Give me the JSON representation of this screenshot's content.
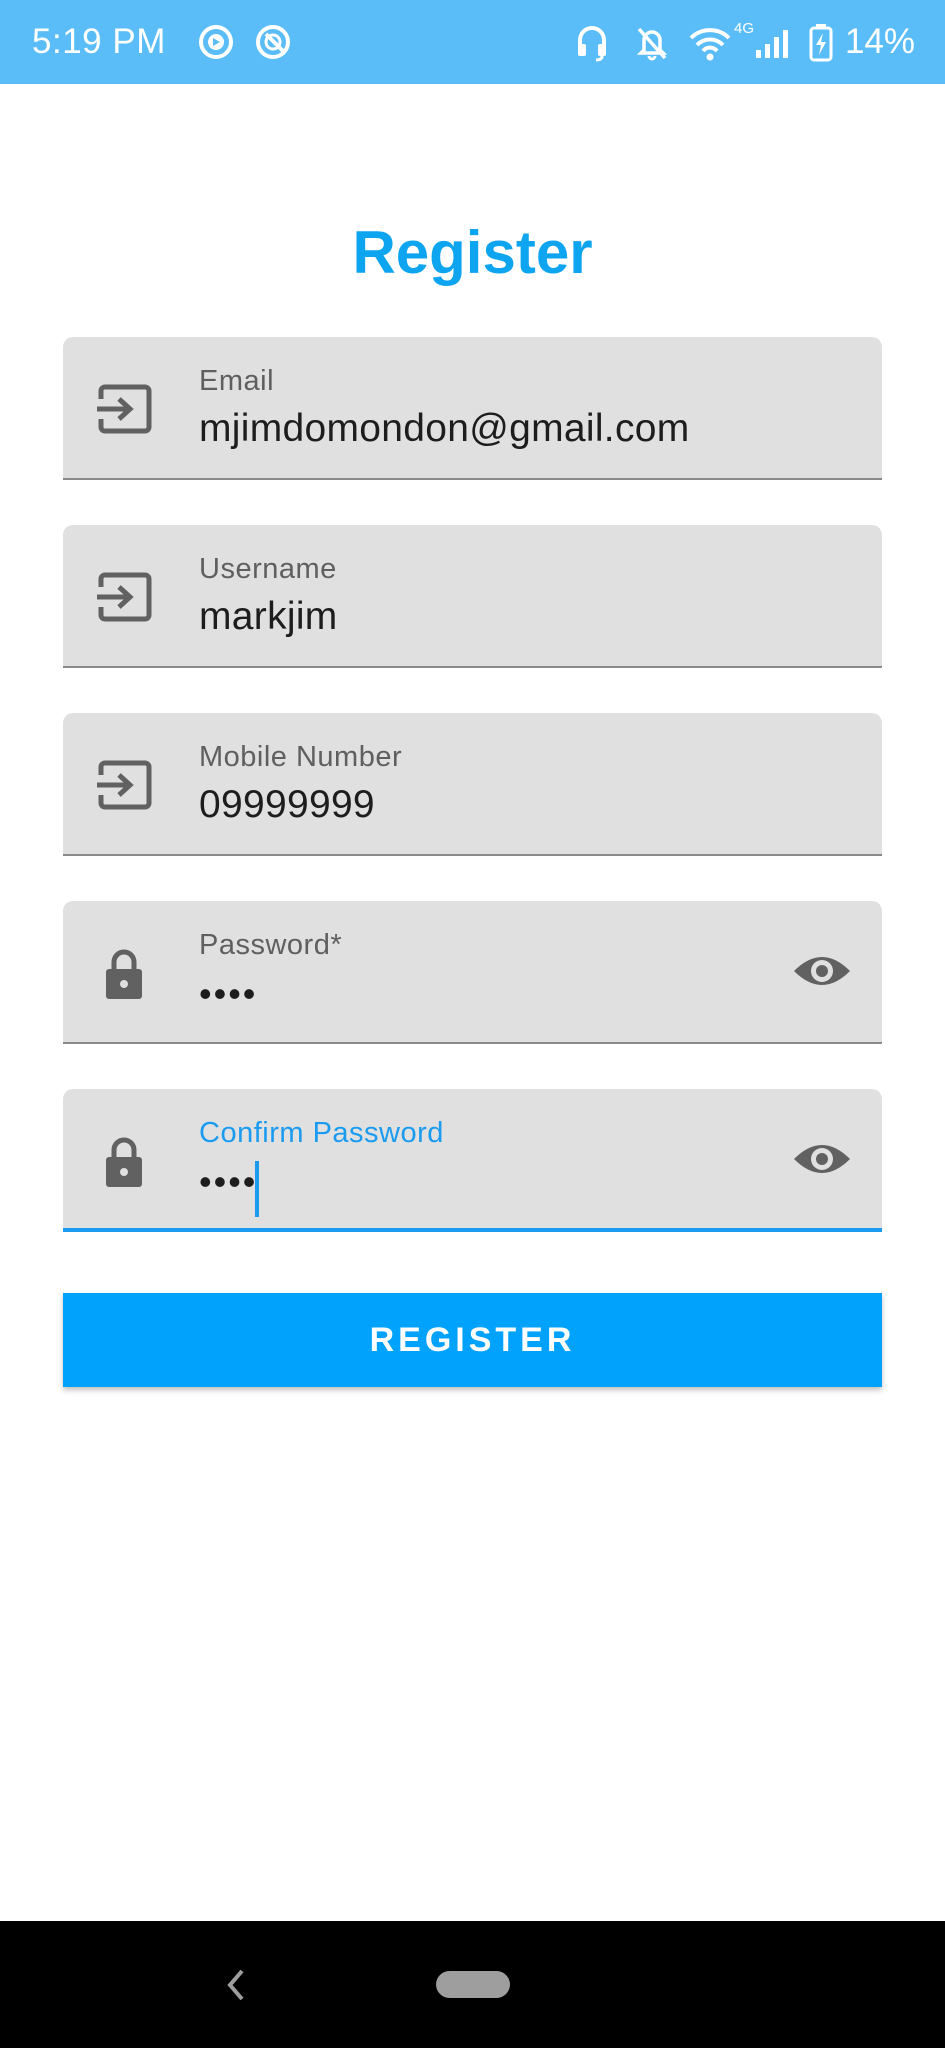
{
  "status_bar": {
    "time": "5:19 PM",
    "network": "4G",
    "battery": "14%",
    "icons": [
      "play-circle-icon",
      "no-entry-icon",
      "headset-icon",
      "bell-off-icon",
      "wifi-icon",
      "signal-icon",
      "battery-charging-icon"
    ]
  },
  "page": {
    "title": "Register"
  },
  "form": {
    "email": {
      "label": "Email",
      "value": "mjimdomondon@gmail.com",
      "icon": "login-icon"
    },
    "username": {
      "label": "Username",
      "value": "markjim",
      "icon": "login-icon"
    },
    "mobile": {
      "label": "Mobile Number",
      "value": "09999999",
      "icon": "login-icon"
    },
    "password": {
      "label": "Password*",
      "value": "••••",
      "icon": "lock-icon",
      "trailing_icon": "eye-icon"
    },
    "confirm_password": {
      "label": "Confirm Password",
      "value": "••••",
      "icon": "lock-icon",
      "trailing_icon": "eye-icon",
      "focused": true
    }
  },
  "register_button": {
    "label": "REGISTER"
  },
  "colors": {
    "status_bar": "#5bbdf7",
    "accent": "#0ea5f0",
    "button": "#00a2fb",
    "field_bg": "#e0e0e0",
    "icon": "#616161"
  }
}
